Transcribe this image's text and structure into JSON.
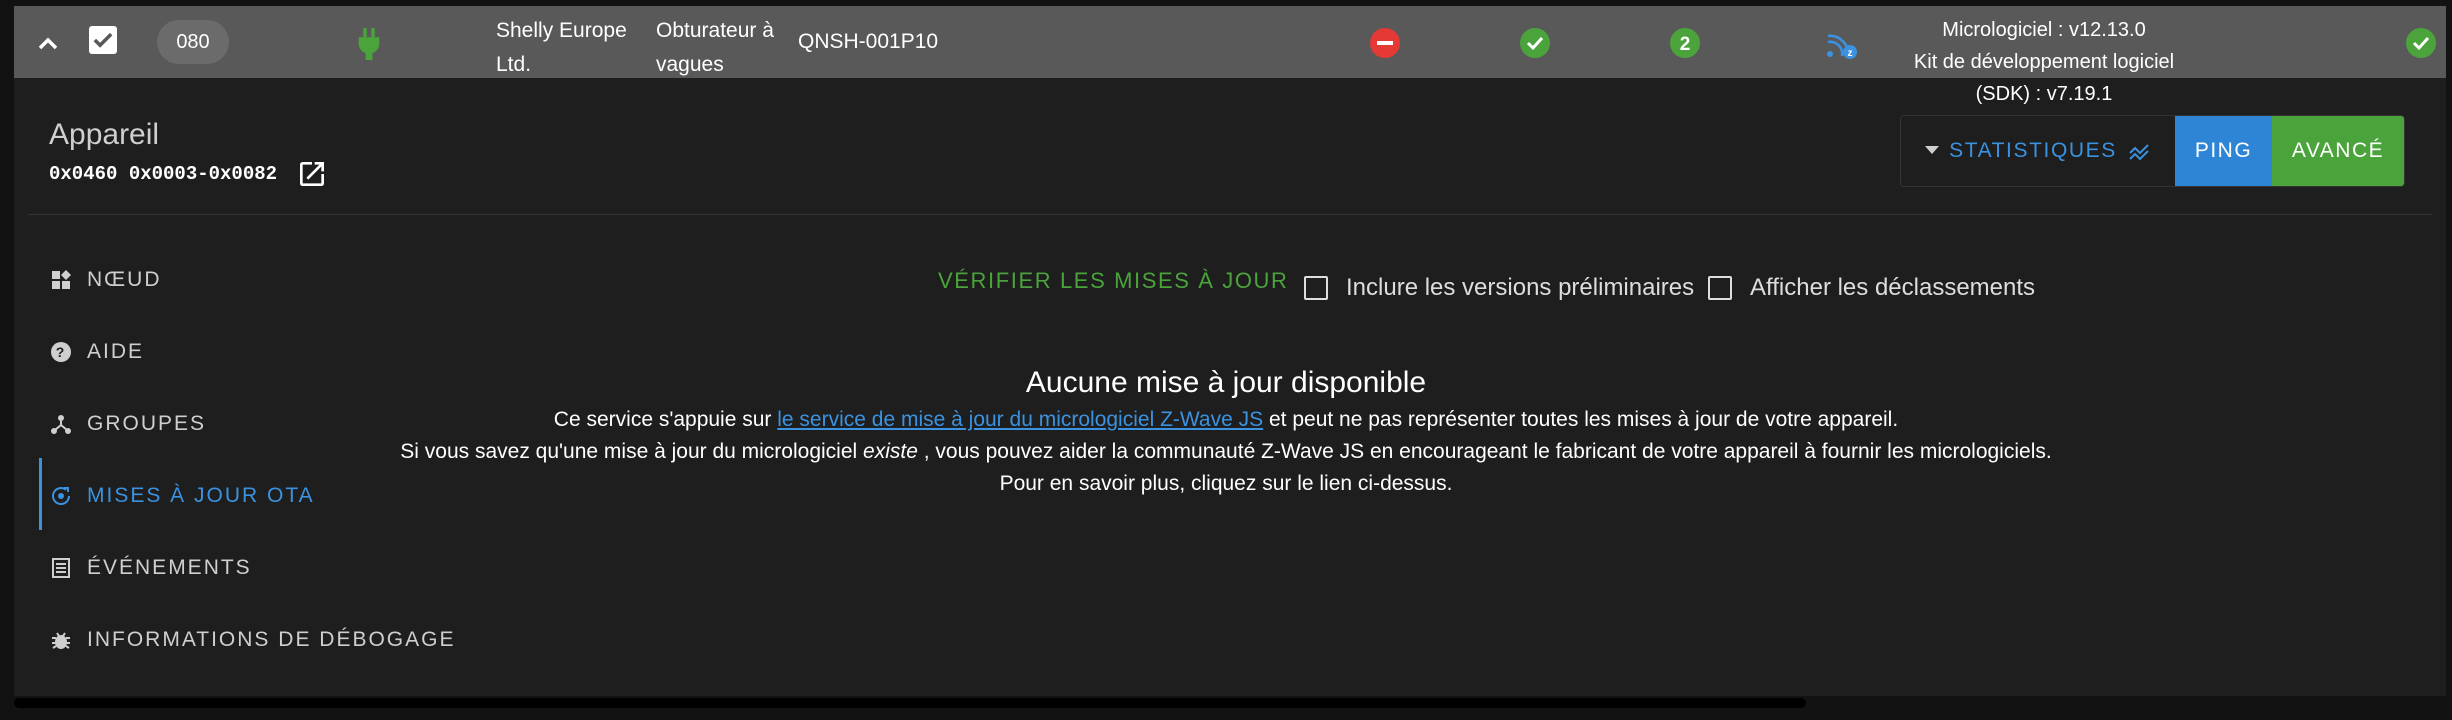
{
  "node": {
    "id": "080",
    "manufacturer": "Shelly Europe Ltd.",
    "product_description": "Obturateur à vagues",
    "product_code": "QNSH-001P10",
    "firmware": "Micrologiciel : v12.13.0",
    "sdk": "Kit de développement logiciel (SDK) : v7.19.1",
    "power_icon": "plug-icon",
    "status_icons": [
      "failed-icon",
      "ready-icon",
      "security-s2-icon",
      "zwave-long-range-icon",
      "interview-complete-icon"
    ],
    "colors": {
      "red": "#e53935",
      "green": "#4ba33c",
      "blue": "#3b92e0"
    }
  },
  "device": {
    "title": "Appareil",
    "ids": "0x0460 0x0003-0x0082"
  },
  "actions": {
    "statistics": "STATISTIQUES",
    "ping": "PING",
    "advanced": "AVANCÉ"
  },
  "tabs": [
    {
      "label": "NŒUD",
      "icon": "widgets-icon"
    },
    {
      "label": "AIDE",
      "icon": "help-icon"
    },
    {
      "label": "GROUPES",
      "icon": "groups-icon"
    },
    {
      "label": "MISES À JOUR OTA",
      "icon": "ota-update-icon",
      "active": true
    },
    {
      "label": "ÉVÉNEMENTS",
      "icon": "events-icon"
    },
    {
      "label": "INFORMATIONS DE DÉBOGAGE",
      "icon": "bug-icon"
    }
  ],
  "ota": {
    "check_label": "VÉRIFIER LES MISES À JOUR",
    "include_prerelease": "Inclure les versions préliminaires",
    "show_downgrades": "Afficher les déclassements",
    "no_update_title": "Aucune mise à jour disponible",
    "line1_prefix": "Ce service s'appuie sur",
    "line1_link": "le service de mise à jour du micrologiciel Z-Wave JS",
    "line1_suffix": "et peut ne pas représenter toutes les mises à jour de votre appareil.",
    "line2_prefix": "Si vous savez qu'une mise à jour du micrologiciel",
    "line2_emph": "existe",
    "line2_suffix": ", vous pouvez aider la communauté Z-Wave JS en encourageant le fabricant de votre appareil à fournir les micrologiciels.",
    "line3": "Pour en savoir plus, cliquez sur le lien ci-dessus."
  }
}
